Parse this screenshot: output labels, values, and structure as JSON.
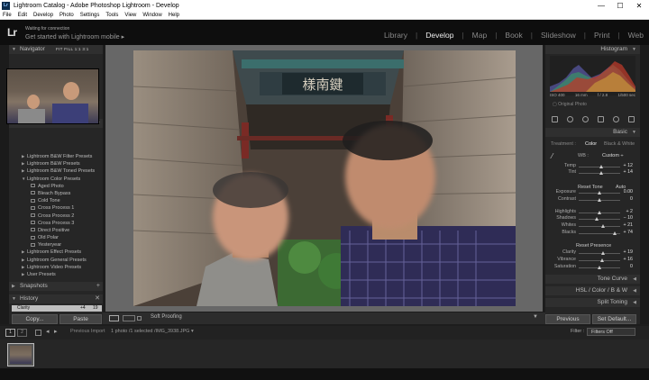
{
  "window": {
    "title": "Lightroom Catalog - Adobe Photoshop Lightroom - Develop",
    "app_icon": "Lr",
    "minimize": "—",
    "maximize": "☐",
    "close": "✕"
  },
  "menu": [
    "File",
    "Edit",
    "Develop",
    "Photo",
    "Settings",
    "Tools",
    "View",
    "Window",
    "Help"
  ],
  "identity": {
    "logo": "Lr",
    "status": "Waiting for connection",
    "mobile": "Get started with Lightroom mobile",
    "mobile_arrow": "▸"
  },
  "modules": [
    {
      "label": "Library",
      "active": false
    },
    {
      "label": "Develop",
      "active": true
    },
    {
      "label": "Map",
      "active": false
    },
    {
      "label": "Book",
      "active": false
    },
    {
      "label": "Slideshow",
      "active": false
    },
    {
      "label": "Print",
      "active": false
    },
    {
      "label": "Web",
      "active": false
    }
  ],
  "left": {
    "navigator": {
      "title": "Navigator",
      "zoom_options": "FIT   FILL   1:1   3:1"
    },
    "presets": {
      "title": "Presets",
      "items": [
        {
          "label": "Lightroom B&W Filter Presets",
          "kind": "folder",
          "open": false
        },
        {
          "label": "Lightroom B&W Presets",
          "kind": "folder",
          "open": false
        },
        {
          "label": "Lightroom B&W Toned Presets",
          "kind": "folder",
          "open": false
        },
        {
          "label": "Lightroom Color Presets",
          "kind": "folder",
          "open": true
        },
        {
          "label": "Aged Photo",
          "kind": "item"
        },
        {
          "label": "Bleach Bypass",
          "kind": "item"
        },
        {
          "label": "Cold Tone",
          "kind": "item"
        },
        {
          "label": "Cross Process 1",
          "kind": "item"
        },
        {
          "label": "Cross Process 2",
          "kind": "item"
        },
        {
          "label": "Cross Process 3",
          "kind": "item"
        },
        {
          "label": "Direct Positive",
          "kind": "item"
        },
        {
          "label": "Old Polar",
          "kind": "item"
        },
        {
          "label": "Yesteryear",
          "kind": "item"
        },
        {
          "label": "Lightroom Effect Presets",
          "kind": "folder",
          "open": false
        },
        {
          "label": "Lightroom General Presets",
          "kind": "folder",
          "open": false
        },
        {
          "label": "Lightroom Video Presets",
          "kind": "folder",
          "open": false
        },
        {
          "label": "User Presets",
          "kind": "folder",
          "open": false
        }
      ]
    },
    "snapshots": {
      "title": "Snapshots"
    },
    "history": {
      "title": "History",
      "row": {
        "label": "Clarity",
        "delta": "+4",
        "value": "19"
      }
    },
    "copy_button": "Copy...",
    "paste_button": "Paste"
  },
  "toolbar": {
    "soft_proofing": "Soft Proofing"
  },
  "right": {
    "histogram": {
      "title": "Histogram",
      "iso": "ISO 400",
      "focal": "16 mm",
      "aperture": "f / 2.8",
      "shutter": "1/500 sec"
    },
    "original_photo": "Original Photo",
    "basic": {
      "title": "Basic",
      "treatment_label": "Treatment :",
      "color": "Color",
      "bw": "Black & White",
      "wb_label": "WB :",
      "wb_value": "Custom ÷",
      "tone_heading": "Reset Tone",
      "auto": "Auto",
      "presence_heading": "Reset Presence",
      "sliders": [
        {
          "label": "Temp",
          "value": "+ 12",
          "pos": 0.55,
          "group": "wb"
        },
        {
          "label": "Tint",
          "value": "+ 14",
          "pos": 0.56,
          "group": "wb"
        },
        {
          "label": "Exposure",
          "value": "0.00",
          "pos": 0.5,
          "group": "tone"
        },
        {
          "label": "Contrast",
          "value": "0",
          "pos": 0.5,
          "group": "tone"
        },
        {
          "label": "Highlights",
          "value": "+ 2",
          "pos": 0.51,
          "group": "tone2"
        },
        {
          "label": "Shadows",
          "value": "− 10",
          "pos": 0.45,
          "group": "tone2"
        },
        {
          "label": "Whites",
          "value": "+ 21",
          "pos": 0.6,
          "group": "tone2"
        },
        {
          "label": "Blacks",
          "value": "+ 74",
          "pos": 0.87,
          "group": "tone2"
        },
        {
          "label": "Clarity",
          "value": "+ 19",
          "pos": 0.6,
          "group": "presence"
        },
        {
          "label": "Vibrance",
          "value": "+ 16",
          "pos": 0.58,
          "group": "presence"
        },
        {
          "label": "Saturation",
          "value": "0",
          "pos": 0.5,
          "group": "presence"
        }
      ]
    },
    "tone_curve": "Tone Curve",
    "hsl": "HSL  /  Color  /  B & W",
    "split_toning": "Split Toning",
    "previous_button": "Previous",
    "reset_button": "Set Default..."
  },
  "filmstrip": {
    "pages": [
      "1",
      "2"
    ],
    "previous_import": "Previous Import",
    "path": "1 photo /1 selected /IMG_3938.JPG ▾",
    "filter_label": "Filter :",
    "filter_value": "Filters Off"
  },
  "photo": {
    "sign": "樣南鍵"
  },
  "colors": {
    "active_module": "#eeeeee",
    "panel": "#262626",
    "center_bg": "#676767"
  }
}
